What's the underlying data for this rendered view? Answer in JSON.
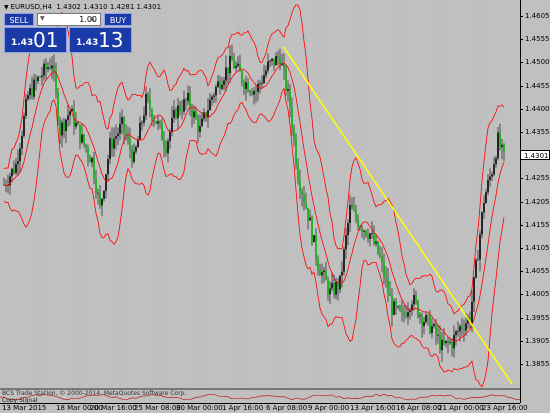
{
  "header": {
    "symbol": "EURUSD,H4",
    "ohlc": "1.4302 1.4310 1.4281 1.4301"
  },
  "trade_panel": {
    "sell_label": "SELL",
    "buy_label": "BUY",
    "lot_value": "1.00",
    "sell_price_small": "1.43",
    "sell_price_big": "01",
    "buy_price_small": "1.43",
    "buy_price_big": "13"
  },
  "price_axis": {
    "labels": [
      "1.4605",
      "1.4555",
      "1.4500",
      "1.4455",
      "1.4400",
      "1.4355",
      "1.4301",
      "1.4255",
      "1.4205",
      "1.4155",
      "1.4105",
      "1.4055",
      "1.4005",
      "1.3955",
      "1.3905",
      "1.3855"
    ],
    "current": "1.4301"
  },
  "time_axis": {
    "labels": [
      "13 Mar 2015",
      "18 Mar 00:00",
      "20 Mar 16:00",
      "25 Mar 08:00",
      "30 Mar 00:00",
      "1 Apr 16:00",
      "6 Apr 08:00",
      "9 Apr 00:00",
      "13 Apr 16:00",
      "16 Apr 08:00",
      "21 Apr 00:00",
      "23 Apr 16:00"
    ]
  },
  "footer": {
    "copyright": "BCS Trade Station, © 2000-2014, MetaQuotes Software Corp.",
    "subwindow": "Copy Signal"
  },
  "colors": {
    "background": "#c0c0c0",
    "candle_up": "#000000",
    "candle_down": "#00b000",
    "bollinger": "#ff0000",
    "trendline": "#ffff00",
    "panel_blue": "#1a3aa8"
  },
  "chart_data": {
    "type": "candlestick",
    "symbol": "EURUSD",
    "timeframe": "H4",
    "ylim": [
      1.3835,
      1.4625
    ],
    "indicators": [
      "Bollinger Bands"
    ],
    "trendline": {
      "from": [
        0.545,
        1.453
      ],
      "to": [
        0.985,
        1.3845
      ]
    }
  }
}
